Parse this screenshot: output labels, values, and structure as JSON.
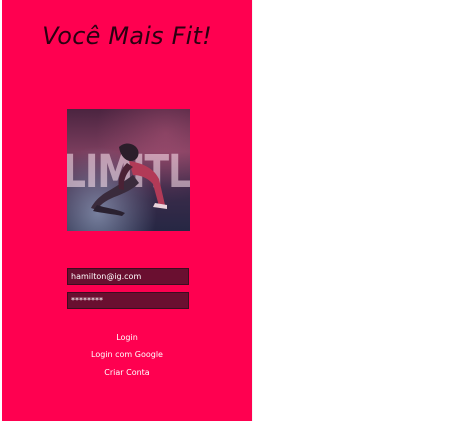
{
  "app": {
    "title": "Você Mais Fit!"
  },
  "hero": {
    "overlay_text": "LIMITLESS"
  },
  "form": {
    "email_value": "hamilton@ig.com",
    "password_value": "********"
  },
  "actions": {
    "login_label": "Login",
    "google_label": "Login com Google",
    "create_label": "Criar Conta"
  },
  "colors": {
    "background": "#ff0050",
    "title": "#2a0011",
    "field_background": "#6a0f30",
    "text_light": "#ffffff"
  }
}
